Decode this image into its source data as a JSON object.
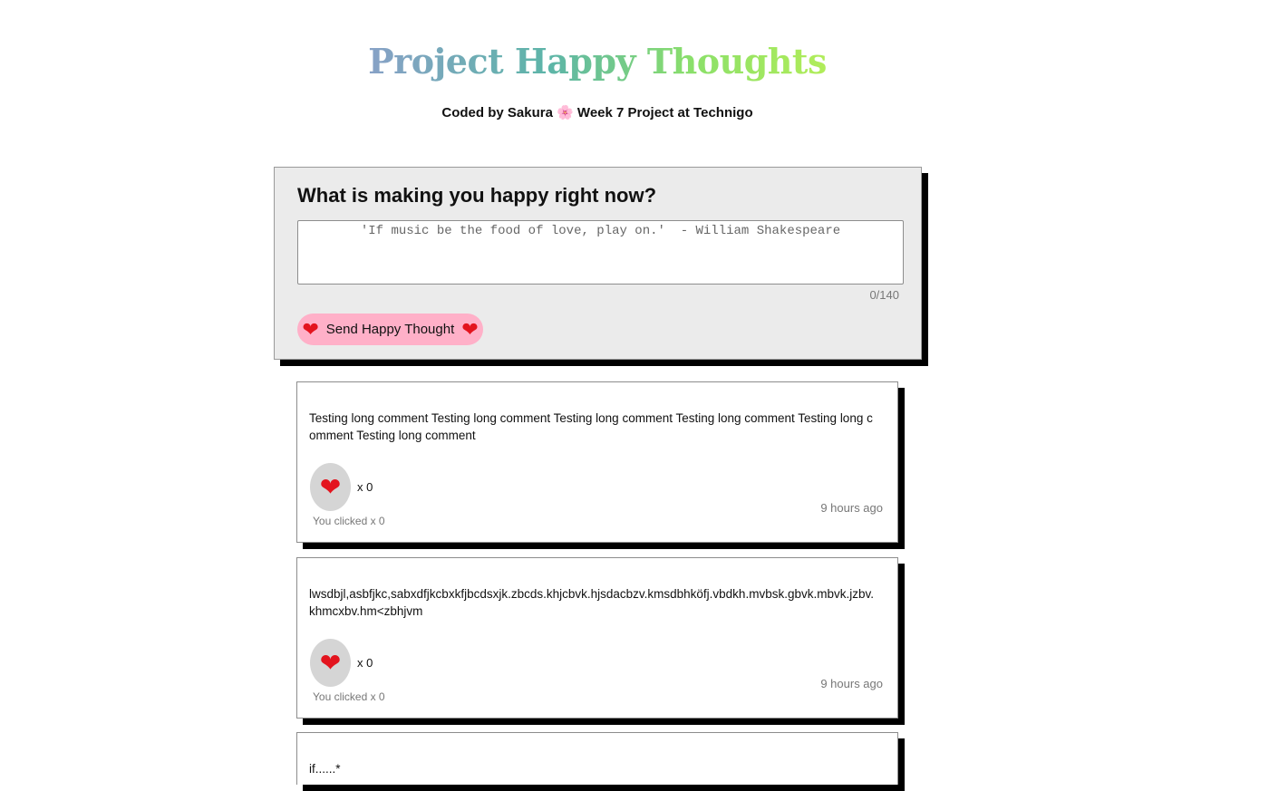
{
  "header": {
    "title": "Project Happy Thoughts",
    "subtitle": "Coded by Sakura 🌸 Week 7 Project at Technigo"
  },
  "form": {
    "heading": "What is making you happy right now?",
    "placeholder": "'If music be the food of love, play on.'  - William Shakespeare",
    "counter": "0/140",
    "button_label": "Send Happy Thought",
    "button_icon": "heart-icon"
  },
  "thoughts": [
    {
      "message": "Testing long comment Testing long comment Testing long comment Testing long comment Testing long comment Testing long comment",
      "likes": "x 0",
      "you_clicked": "You clicked x 0",
      "time": "9 hours ago"
    },
    {
      "message": "lwsdbjl,asbfjkc,sabxdfjkcbxkfjbcdsxjk.zbcds.khjcbvk.hjsdacbzv.kmsdbhköfj.vbdkh.mvbsk.gbvk.mbvk.jzbv.khmcxbv.hm<zbhjvm",
      "likes": "x 0",
      "you_clicked": "You clicked x 0",
      "time": "9 hours ago"
    },
    {
      "message": "if......*"
    }
  ],
  "colors": {
    "form_bg": "#ebebeb",
    "button_bg": "#ffb0c8",
    "heart": "#e3141e",
    "like_bg": "#d5d5d5",
    "shadow": "#000000"
  }
}
